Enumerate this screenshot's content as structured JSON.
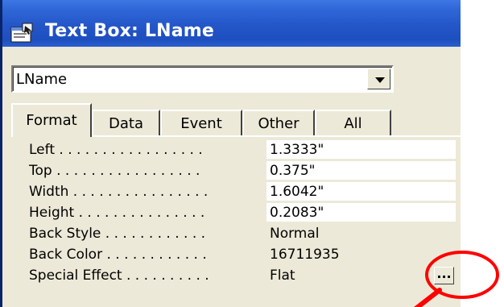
{
  "window": {
    "title": "Text Box: LName",
    "title_icon": "properties-icon"
  },
  "selector": {
    "value": "LName",
    "dropdown_icon": "chevron-down-icon"
  },
  "tabs": [
    {
      "label": "Format",
      "active": true
    },
    {
      "label": "Data",
      "active": false
    },
    {
      "label": "Event",
      "active": false
    },
    {
      "label": "Other",
      "active": false
    },
    {
      "label": "All",
      "active": false
    }
  ],
  "properties": [
    {
      "label": "Left . . . . . . . . . . . . . . . . .",
      "value": "1.3333\""
    },
    {
      "label": "Top . . . . . . . . . . . . . . . . .",
      "value": "0.375\""
    },
    {
      "label": "Width . . . . . . . . . . . . . . . .",
      "value": "1.6042\""
    },
    {
      "label": "Height . . . . . . . . . . . . . . .",
      "value": "0.2083\""
    },
    {
      "label": "Back Style . . . . . . . . . . . .",
      "value": "Normal"
    },
    {
      "label": "Back Color . . . . . . . . . . . .",
      "value": "16711935"
    },
    {
      "label": "Special Effect . . . . . . . . . .",
      "value": "Flat"
    }
  ],
  "builder_button": {
    "label": "..."
  },
  "colors": {
    "titlebar": "#2456c8",
    "window_bg": "#ece9d8",
    "annotation": "#ff0000"
  }
}
